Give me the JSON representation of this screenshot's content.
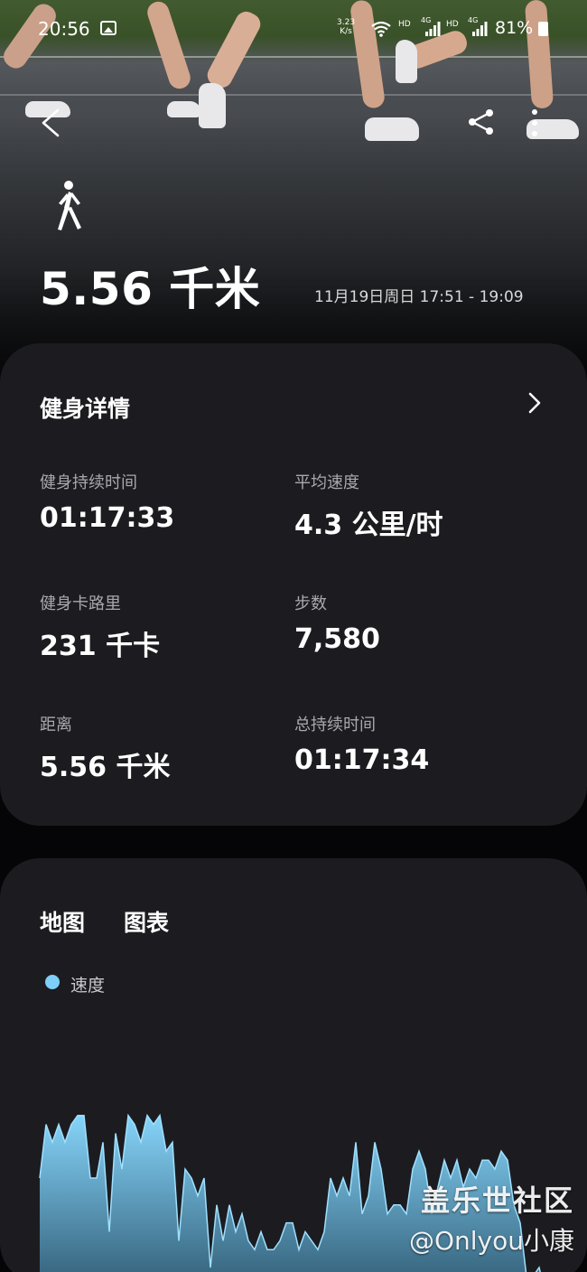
{
  "status_bar": {
    "time": "20:56",
    "net_speed_value": "3.23",
    "net_speed_unit": "K/s",
    "sim1_label": "HD",
    "sim1_net": "4G",
    "sim2_label": "HD",
    "sim2_net": "4G",
    "battery": "81%"
  },
  "header": {
    "activity_icon": "walk-icon",
    "distance": "5.56 千米",
    "date_range": "11月19日周日 17:51 - 19:09"
  },
  "details": {
    "title": "健身详情",
    "metrics": [
      {
        "label": "健身持续时间",
        "value": "01:17:33"
      },
      {
        "label": "平均速度",
        "value": "4.3 公里/时"
      },
      {
        "label": "健身卡路里",
        "value": "231 千卡"
      },
      {
        "label": "步数",
        "value": "7,580"
      },
      {
        "label": "距离",
        "value": "5.56 千米"
      },
      {
        "label": "总持续时间",
        "value": "01:17:34"
      }
    ]
  },
  "chart_section": {
    "tabs": [
      "地图",
      "图表"
    ],
    "legend_label": "速度",
    "accent_color": "#7dcff8"
  },
  "chart_data": {
    "type": "area",
    "series": [
      {
        "name": "速度",
        "values": [
          4.2,
          4.8,
          4.6,
          4.8,
          4.6,
          4.8,
          4.9,
          4.9,
          4.2,
          4.2,
          4.6,
          3.6,
          4.7,
          4.3,
          4.9,
          4.8,
          4.6,
          4.9,
          4.8,
          4.9,
          4.5,
          4.6,
          3.5,
          4.3,
          4.2,
          4.0,
          4.2,
          3.2,
          3.9,
          3.5,
          3.9,
          3.6,
          3.8,
          3.5,
          3.4,
          3.6,
          3.4,
          3.4,
          3.5,
          3.7,
          3.7,
          3.4,
          3.6,
          3.5,
          3.4,
          3.6,
          4.2,
          4.0,
          4.2,
          4.0,
          4.6,
          3.8,
          4.0,
          4.6,
          4.3,
          3.8,
          3.9,
          3.9,
          3.8,
          4.3,
          4.5,
          4.3,
          3.8,
          4.1,
          4.4,
          4.2,
          4.4,
          4.1,
          4.3,
          4.2,
          4.4,
          4.4,
          4.3,
          4.5,
          4.4,
          3.9,
          3.7,
          3.1,
          3.1,
          3.2,
          2.9
        ]
      }
    ],
    "colors": {
      "fill_top": "#86d4fa",
      "fill_bottom": "#2f5a72",
      "stroke": "#9fe0ff"
    }
  },
  "watermark": {
    "line1": "盖乐世社区",
    "line2": "@Onlyou小康"
  }
}
